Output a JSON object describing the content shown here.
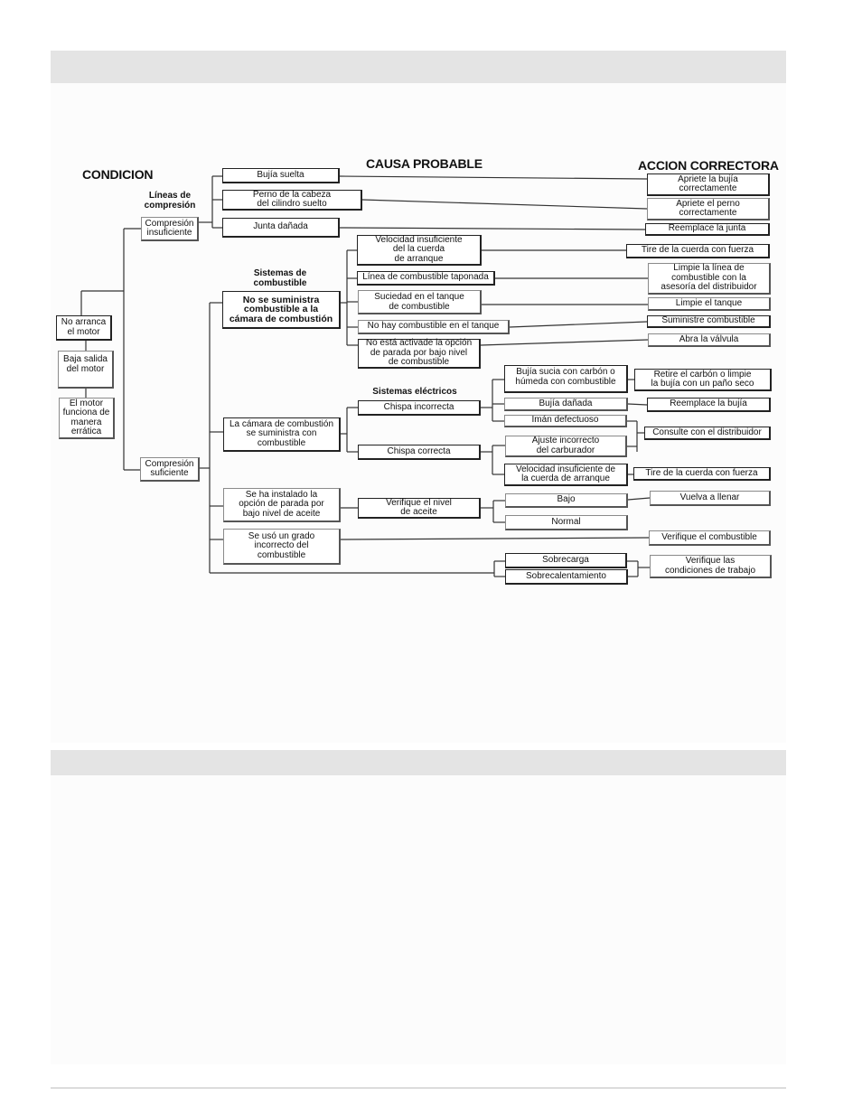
{
  "headers": {
    "condition": "CONDICION",
    "cause": "CAUSA PROBABLE",
    "action": "ACCION CORRECTORA"
  },
  "subheaders": {
    "compression_lines": "Líneas de\ncompresión",
    "fuel_systems": "Sistemas de\ncombustible",
    "electrical_systems": "Sistemas eléctricos"
  },
  "conditions": [
    "No arranca\nel motor",
    "Baja salida\ndel motor",
    "El motor\nfunciona de\nmanera\nerrática"
  ],
  "compression": {
    "insufficient": "Compresión\ninsuficiente",
    "sufficient": "Compresión\nsuficiente"
  },
  "insufficient_causes": [
    {
      "cause": "Bujía suelta",
      "action": "Apriete la bujía\ncorrectamente"
    },
    {
      "cause": "Perno de la cabeza\ndel cilindro suelto",
      "action": "Apriete el perno\ncorrectamente"
    },
    {
      "cause": "Junta dañada",
      "action": "Reemplace la junta"
    }
  ],
  "sufficient_branches": {
    "no_fuel": "No se suministra\ncombustible a la\ncámara de combustión",
    "fuel_ok": "La cámara de combustión\nse suministra con\ncombustible",
    "low_oil": "Se ha instalado la\nopción de parada por\nbajo nivel de aceite",
    "wrong_fuel": "Se usó un grado\nincorrecto del\ncombustible"
  },
  "fuel_causes": [
    {
      "cause": "Velocidad insuficiente\ndel la cuerda\nde arranque",
      "action": "Tire de la cuerda con fuerza"
    },
    {
      "cause": "Línea de combustible taponada",
      "action": "Limpie la línea de\ncombustible con la\nasesoría del distribuidor"
    },
    {
      "cause": "Suciedad en el tanque\nde combustible",
      "action": "Limpie el tanque"
    },
    {
      "cause": "No hay combustible en el tanque",
      "action": "Suministre combustible"
    },
    {
      "cause": "No está activade la opción\nde parada por bajo nivel\nde combustible",
      "action": "Abra la válvula"
    }
  ],
  "spark": {
    "incorrect": "Chispa incorrecta",
    "correct": "Chispa correcta"
  },
  "spark_incorrect_causes": [
    {
      "cause": "Bujía sucia con carbón o\nhúmeda con combustible",
      "action": "Retire el carbón o limpie\nla bujía con un paño seco"
    },
    {
      "cause": "Bujía dañada",
      "action": "Reemplace la bujía"
    },
    {
      "cause": "Imán defectuoso"
    }
  ],
  "spark_correct_causes": [
    {
      "cause": "Ajuste incorrecto\ndel carburador"
    },
    {
      "cause": "Velocidad insuficiente de\nla cuerda de arranque",
      "action": "Tire de la cuerda con fuerza"
    }
  ],
  "shared_action_distributor": "Consulte con el distribuidor",
  "oil": {
    "check": "Verifique el nivel\nde aceite",
    "low": "Bajo",
    "normal": "Normal",
    "refill": "Vuelva a llenar"
  },
  "wrong_fuel_action": "Verifique el combustible",
  "load": {
    "overload": "Sobrecarga",
    "overheat": "Sobrecalentamiento",
    "action": "Verifique las\ncondiciones de trabajo"
  }
}
